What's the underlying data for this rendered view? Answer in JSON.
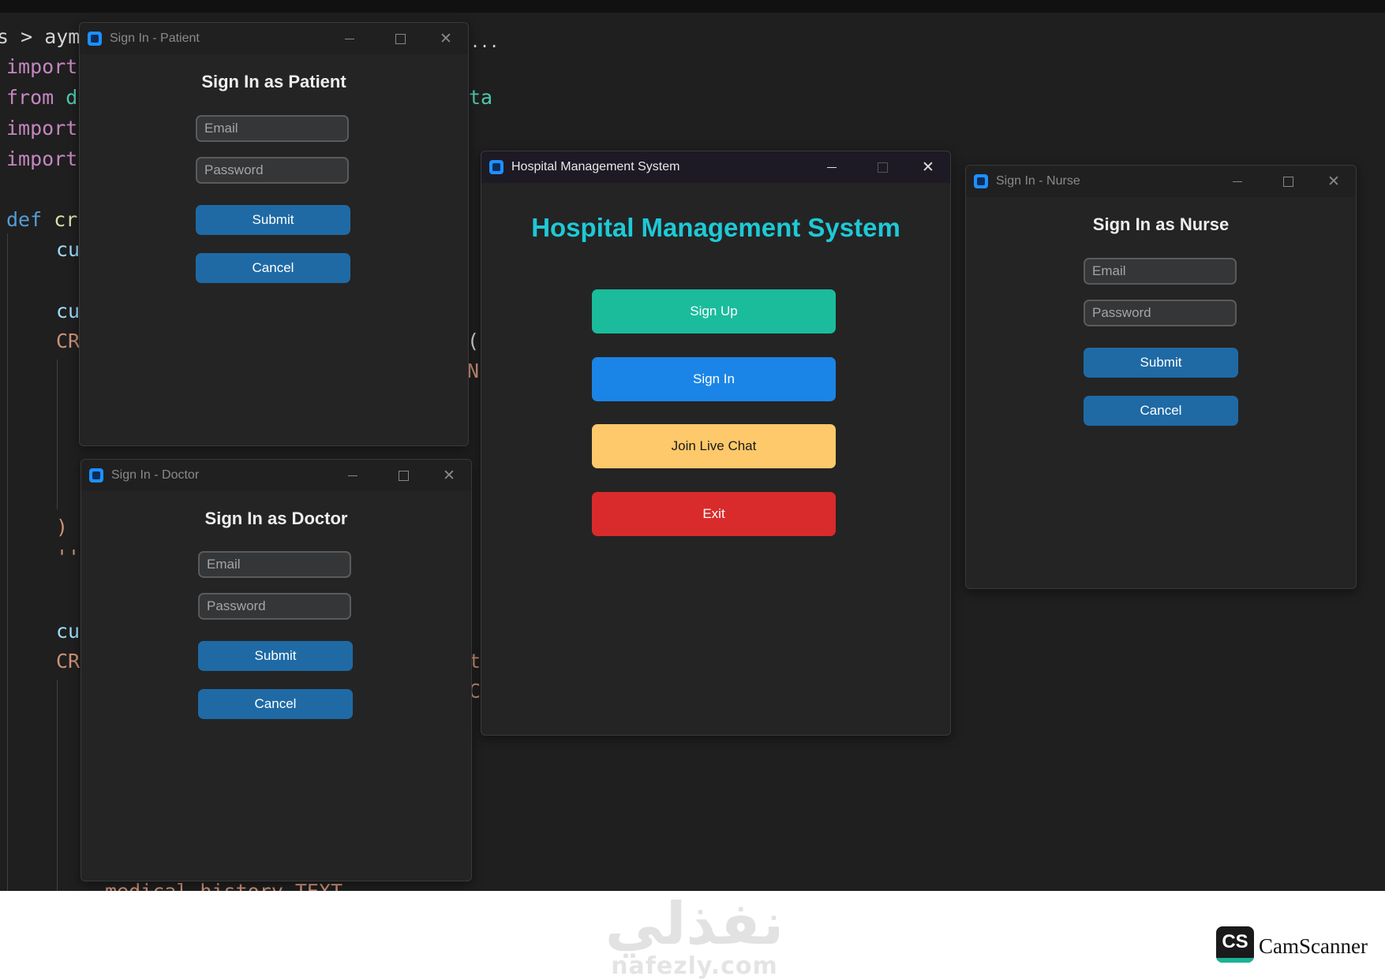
{
  "editor": {
    "breadcrumb": "s > ayma",
    "breadcrumb_tail": "...",
    "lines": {
      "l1_kw": "import",
      "l2_kw": "from",
      "l2_rest": " d",
      "l2_tail": "ta",
      "l3_kw": "import",
      "l4_kw": "import",
      "l5_kw": "def",
      "l5_rest": " cr",
      "l6": "cu",
      "l7": "cu",
      "l8": "CR",
      "l8_tail": "(",
      "l9_tail": "N",
      "l10": ")",
      "l11": "''",
      "l12": "cu",
      "l13": "CR",
      "l13_tail": "t",
      "l14_tail": "C",
      "l15": "medical_history TEXT"
    }
  },
  "windows": {
    "patient": {
      "title": "Sign In - Patient",
      "heading": "Sign In as Patient",
      "email_placeholder": "Email",
      "password_placeholder": "Password",
      "submit": "Submit",
      "cancel": "Cancel"
    },
    "doctor": {
      "title": "Sign In - Doctor",
      "heading": "Sign In as Doctor",
      "email_placeholder": "Email",
      "password_placeholder": "Password",
      "submit": "Submit",
      "cancel": "Cancel"
    },
    "nurse": {
      "title": "Sign In - Nurse",
      "heading": "Sign In as Nurse",
      "email_placeholder": "Email",
      "password_placeholder": "Password",
      "submit": "Submit",
      "cancel": "Cancel"
    },
    "main": {
      "title": "Hospital Management System",
      "heading": "Hospital Management System",
      "buttons": {
        "sign_up": "Sign Up",
        "sign_in": "Sign In",
        "live_chat": "Join Live Chat",
        "exit": "Exit"
      }
    }
  },
  "colors": {
    "accent_title": "#1ec9d6",
    "sign_up": "#1abc9c",
    "sign_in": "#1a85e6",
    "live_chat": "#fec96a",
    "exit": "#d92b2b",
    "dialog_button": "#1f6aa5"
  },
  "icons": {
    "app": "app-icon",
    "minimize": "minimize-icon",
    "maximize": "maximize-icon",
    "close": "close-icon"
  },
  "watermarks": {
    "site_arabic": "نفذلي",
    "site_latin": "nafezly.com",
    "scanner_logo": "CS",
    "scanner_name": "CamScanner"
  }
}
